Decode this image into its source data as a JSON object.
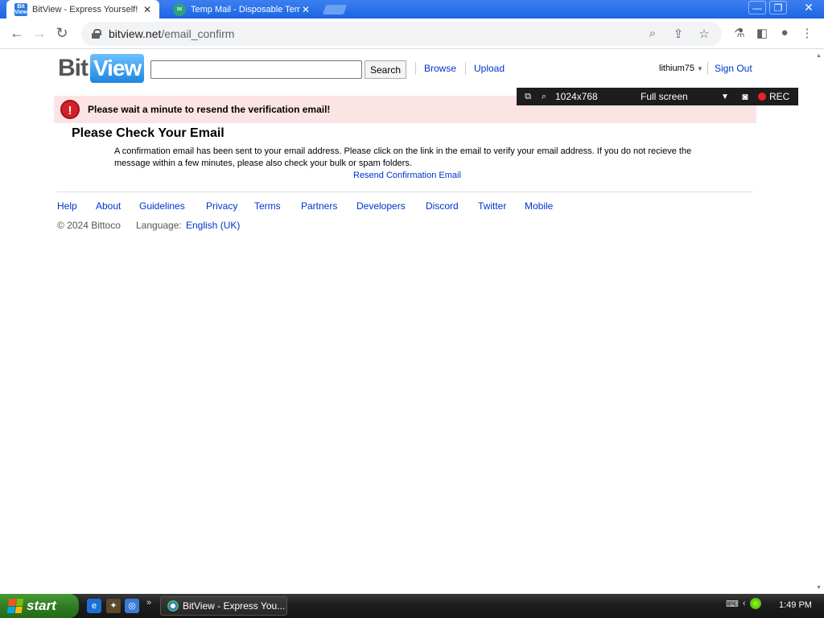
{
  "browser": {
    "tabs": [
      {
        "title": "BitView - Express Yourself!",
        "close": "✕"
      },
      {
        "title": "Temp Mail - Disposable Temporary Email",
        "close": "✕"
      }
    ],
    "window_controls": {
      "minimize": "—",
      "restore": "❐",
      "close": "✕"
    },
    "nav": {
      "back": "←",
      "forward": "→",
      "reload": "↻"
    },
    "url_host": "bitview.net",
    "url_path": "/email_confirm",
    "omnibox_icons": [
      "zoom-icon",
      "share-icon",
      "star-icon"
    ],
    "toolbar_icons": [
      "labs-icon",
      "side-panel-icon",
      "profile-icon",
      "menu-icon"
    ]
  },
  "site": {
    "logo": {
      "bit": "Bit",
      "view": "View"
    },
    "search": {
      "value": "",
      "button": "Search"
    },
    "nav_links": [
      "Browse",
      "Upload"
    ],
    "username": "lithium75",
    "sign_out": "Sign Out"
  },
  "alert": {
    "badge": "!",
    "message": "Please wait a minute to resend the verification email!"
  },
  "recorder": {
    "resolution": "1024x768",
    "mode": "Full screen",
    "rec": "REC"
  },
  "content": {
    "heading": "Please Check Your Email",
    "body": "A confirmation email has been sent to your email address. Please click on the link in the email to verify your email address. If you do not recieve the message within a few minutes, please also check your bulk or spam folders.",
    "resend_link": "Resend Confirmation Email"
  },
  "footer": {
    "links": [
      "Help",
      "About",
      "Guidelines",
      "Privacy",
      "Terms",
      "Partners",
      "Developers",
      "Discord",
      "Twitter",
      "Mobile"
    ],
    "copyright": "© 2024 Bittoco",
    "language_label": "Language:",
    "language_value": "English (UK)"
  },
  "taskbar": {
    "start": "start",
    "window_button": "BitView - Express You...",
    "clock": "1:49 PM"
  }
}
